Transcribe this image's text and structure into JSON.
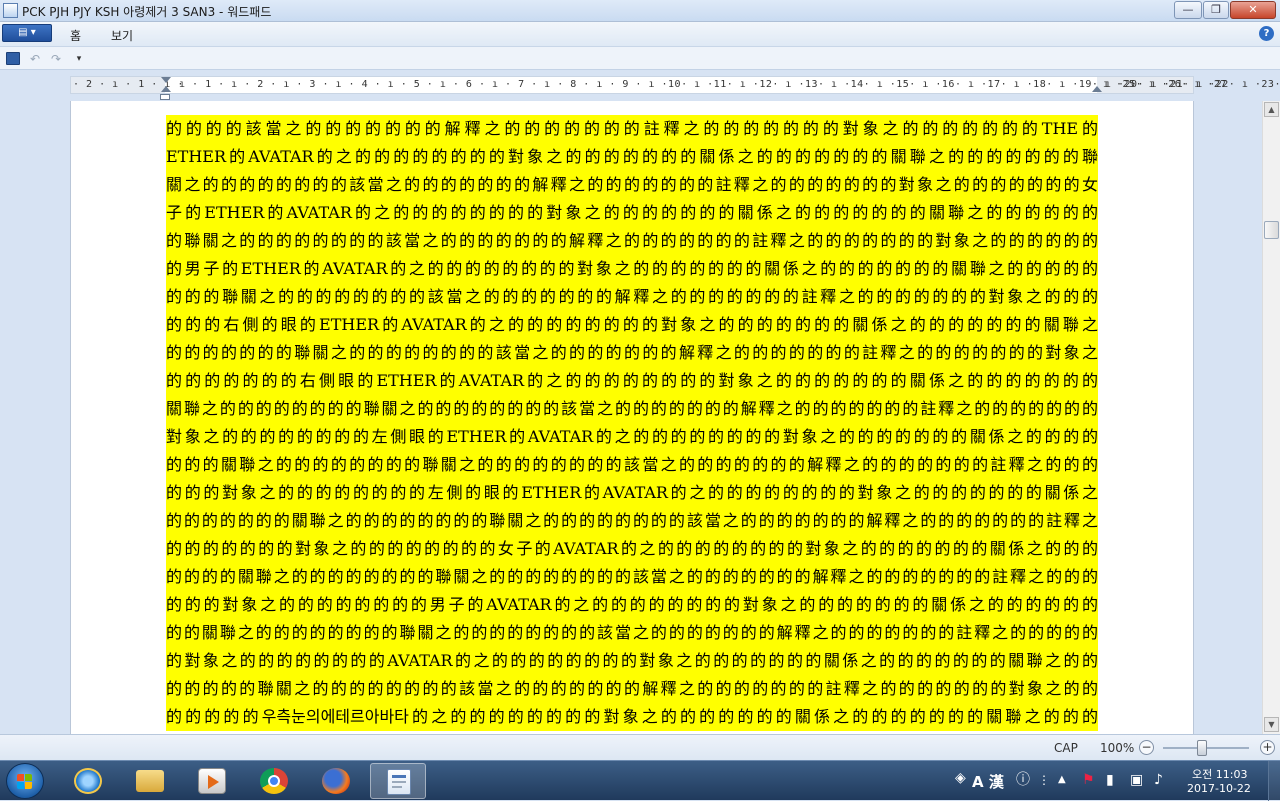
{
  "window": {
    "title": "PCK PJH PJY KSH 아령제거 3 SAN3 - 워드패드",
    "minimize_glyph": "—",
    "maximize_glyph": "❐",
    "close_glyph": "✕"
  },
  "menu": {
    "file_glyph": "▤ ▾",
    "tabs": [
      "홈",
      "보기"
    ],
    "help_glyph": "?"
  },
  "quick_access": {
    "undo_glyph": "↶",
    "redo_glyph": "↷",
    "customize_glyph": "▾"
  },
  "ruler": {
    "ticks_left": "· 2 · ı · 1 · ı ·",
    "ticks_main": "ı · 1 · ı · 2 · ı · 3 · ı · 4 · ı · 5 · ı · 6 · ı · 7 · ı · 8 · ı · 9 · ı ·10· ı ·11· ı ·12· ı ·13· ı ·14· ı ·15· ı ·16· ı ·17· ı ·18· ı ·19· ı ·20· ı ·21· ı ·22· ı ·23· ı ·24·",
    "ticks_right": "ı ·25· ı ·26· ı ·27"
  },
  "document": {
    "lines": [
      "的的的的該當之的的的的的的的解釋之的的的的的的的註釋之的的的的的的的對象之的的的的的的的THE的",
      "ETHER的AVATAR的之的的的的的的的的對象之的的的的的的的關係之的的的的的的的關聯之的的的的的的的聯",
      "關之的的的的的的的的該當之的的的的的的的解釋之的的的的的的的註釋之的的的的的的的對象之的的的的的的的女",
      "子的ETHER的AVATAR的之的的的的的的的的對象之的的的的的的的關係之的的的的的的的關聯之的的的的的的",
      "的聯關之的的的的的的的的該當之的的的的的的的解釋之的的的的的的的註釋之的的的的的的的對象之的的的的的的",
      "的男子的ETHER的AVATAR的之的的的的的的的的對象之的的的的的的的關係之的的的的的的的關聯之的的的的的",
      "的的的聯關之的的的的的的的的該當之的的的的的的的解釋之的的的的的的的註釋之的的的的的的的對象之的的的",
      "的的的右側的眼的ETHER的AVATAR的之的的的的的的的的對象之的的的的的的的關係之的的的的的的的關聯之",
      "的的的的的的的聯關之的的的的的的的的該當之的的的的的的的解釋之的的的的的的的註釋之的的的的的的的對象之",
      "的的的的的的的右側眼的ETHER的AVATAR的之的的的的的的的的對象之的的的的的的的關係之的的的的的的的",
      "關聯之的的的的的的的的聯關之的的的的的的的的該當之的的的的的的的解釋之的的的的的的的註釋之的的的的的的的",
      "對象之的的的的的的的的左側眼的ETHER的AVATAR的之的的的的的的的的對象之的的的的的的的關係之的的的的",
      "的的的關聯之的的的的的的的的聯關之的的的的的的的的該當之的的的的的的的解釋之的的的的的的的註釋之的的的",
      "的的的對象之的的的的的的的的左側的眼的ETHER的AVATAR的之的的的的的的的的對象之的的的的的的的關係之",
      "的的的的的的的關聯之的的的的的的的的聯關之的的的的的的的的該當之的的的的的的的解釋之的的的的的的的註釋之",
      "的的的的的的的對象之的的的的的的的的女子的AVATAR的之的的的的的的的的對象之的的的的的的的關係之的的的",
      "的的的的關聯之的的的的的的的的聯關之的的的的的的的的該當之的的的的的的的解釋之的的的的的的的註釋之的的的",
      "的的的對象之的的的的的的的的男子的AVATAR的之的的的的的的的的對象之的的的的的的的關係之的的的的的的",
      "的的關聯之的的的的的的的的聯關之的的的的的的的的該當之的的的的的的的解釋之的的的的的的的註釋之的的的的的",
      "的對象之的的的的的的的的AVATAR的之的的的的的的的的對象之的的的的的的的關係之的的的的的的的關聯之的的",
      "的的的的的聯關之的的的的的的的的該當之的的的的的的的解釋之的的的的的的的註釋之的的的的的的的對象之的的",
      "的的的的的우측눈의에테르아바타的之的的的的的的的的對象之的的的的的的的關係之的的的的的的的關聯之的的的"
    ]
  },
  "scrollbar": {
    "up_glyph": "▲",
    "down_glyph": "▼"
  },
  "status": {
    "caps": "CAP",
    "zoom": "100%",
    "zoom_out": "−",
    "zoom_in": "+",
    "zoom_level": 0.45
  },
  "taskbar": {
    "tray_lang": "A 漢",
    "time": "오전 11:03",
    "date": "2017-10-22"
  },
  "colors": {
    "highlight": "#ffff00",
    "taskbar": "#203a5c",
    "accent": "#1f4e9b"
  }
}
